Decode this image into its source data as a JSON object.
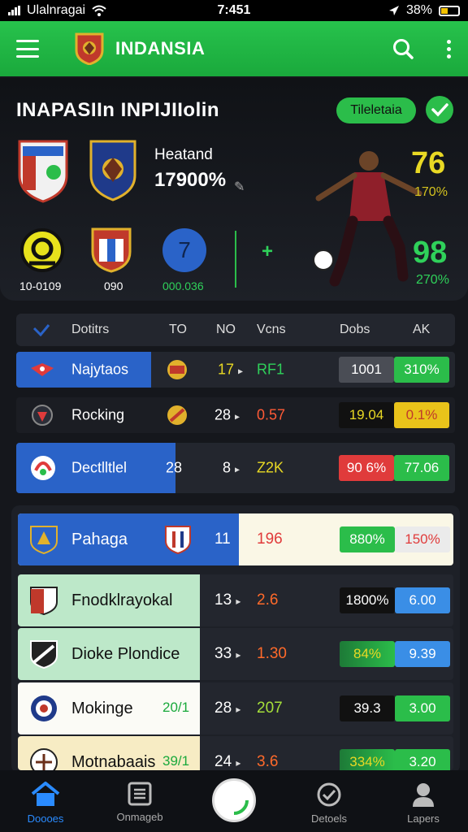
{
  "status_bar": {
    "carrier": "Ulalnragai",
    "time": "7:451",
    "battery": "38%"
  },
  "app_bar": {
    "title": "INDANSIA"
  },
  "match": {
    "title": "INAPASIIn INPIJIIolin",
    "pill": "Tileletaia",
    "headline_label": "Heatand",
    "headline_value": "17900%",
    "score_top": "76",
    "score_top_pct": "170%",
    "score_bottom": "98",
    "score_bottom_pct": "270%",
    "badges": [
      {
        "label": "10-0109"
      },
      {
        "label": "090"
      },
      {
        "label": "000.036",
        "number": "7"
      }
    ]
  },
  "table1": {
    "headers": [
      "Dotitrs",
      "TO",
      "NO",
      "Vcns",
      "Dobs",
      "AK"
    ],
    "rows": [
      {
        "name": "Najytaos",
        "n1": "17",
        "n2": "RF1",
        "b1": "1001",
        "b2": "310%"
      },
      {
        "name": "Rocking",
        "n1": "28",
        "n2": "0.57",
        "b1": "19.04",
        "b2": "0.1%"
      },
      {
        "name": "Dectlltlel",
        "tag": "28",
        "n1": "8",
        "n2": "Z2K",
        "b1": "90 6%",
        "b2": "77.06"
      }
    ]
  },
  "table2": {
    "rows": [
      {
        "name": "Pahaga",
        "n1": "11",
        "n2": "196",
        "b1": "880%",
        "b2": "150%"
      },
      {
        "name": "Fnodklrayokal",
        "n1": "13",
        "n2": "2.6",
        "b1": "1800%",
        "b2": "6.00"
      },
      {
        "name": "Dioke Plondice",
        "n1": "33",
        "n2": "1.30",
        "b1": "84%",
        "b2": "9.39"
      },
      {
        "name": "Mokinge",
        "tag": "20/1",
        "n1": "28",
        "n2": "207",
        "b1": "39.3",
        "b2": "3.00"
      },
      {
        "name": "Motnabaais",
        "tag": "39/1",
        "n1": "24",
        "n2": "3.6",
        "b1": "334%",
        "b2": "3.20"
      }
    ]
  },
  "bottom_nav": {
    "items": [
      "Doooes",
      "Onmageb",
      "Detoels",
      "Lapers"
    ]
  },
  "colors": {
    "brand_green": "#1fb443",
    "accent_blue": "#2a63c8",
    "yellow": "#e9d924"
  }
}
